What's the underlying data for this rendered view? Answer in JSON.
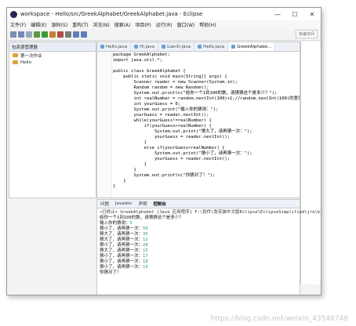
{
  "window": {
    "title": "workspace - Hello/src/GreekAlphabet/GreekAlphabet.java - Eclipse",
    "controls": [
      "—",
      "☐",
      "✕"
    ]
  },
  "menu": [
    "文件(F)",
    "编辑(E)",
    "源码(S)",
    "重构(T)",
    "浏览(N)",
    "搜索(A)",
    "项目(P)",
    "运行(R)",
    "窗口(W)",
    "帮助(H)"
  ],
  "quick_access": "快速访问",
  "left_pane": {
    "tab_label": "包资源管理器",
    "items": [
      "第一次作业",
      "Hello"
    ]
  },
  "editor": {
    "tabs": [
      "Hello.java",
      "Hi.java",
      "LianXi.java",
      "Hello.java",
      "GreekAlphabe..."
    ],
    "active_tab": 4,
    "code_lines": [
      "package GreekAlphabet;",
      "import java.util.*;",
      "",
      "public class GreekAlphabet {",
      "    public static void main(String[] args) {",
      "        Scanner reader = new Scanner(System.in);",
      "        Random random = new Random();",
      "        System.out.println(\"给你一个1到100的数，请猜猜这个是多少？\");",
      "        int realNumber = random.nextInt(100)+1;//random.nextInt(100)的意思",
      "        int yourGuess = 0;",
      "        System.out.print(\"输入你的猜测：\");",
      "        yourGuess = reader.nextInt();",
      "        while(yourGuess!=realNumber) {",
      "            if(yourGuess>realNumber) {",
      "                System.out.print(\"猜大了，请再猜一次：\");",
      "                yourGuess = reader.nextInt();",
      "            }",
      "            else if(yourGuess<realNumber) {",
      "                System.out.print(\"猜小了，请再猜一次：\");",
      "                yourGuess = reader.nextInt();",
      "            }",
      "        }",
      "        System.out.println(\"你猜对了！\");",
      "    }",
      "}"
    ]
  },
  "console": {
    "tabs": [
      "问题",
      "Javadoc",
      "声明",
      "控制台"
    ],
    "active_tab": 3,
    "header": "<已终止> GreekAlphabet [Java 应用程序] F:\\软件\\免安装中文版Eclipse\\EclipseSimplified\\jre\\bin\\javaw.exe (2018年9月2",
    "lines": [
      {
        "text": "给你一个1到100的数，请猜猜这个是多少？",
        "input": ""
      },
      {
        "text": "输入你的猜测：",
        "input": "5"
      },
      {
        "text": "猜小了，请再猜一次：",
        "input": "50"
      },
      {
        "text": "猜大了，请再猜一次：",
        "input": "35"
      },
      {
        "text": "猜大了，请再猜一次：",
        "input": "12"
      },
      {
        "text": "猜小了，请再猜一次：",
        "input": "28"
      },
      {
        "text": "猜大了，请再猜一次：",
        "input": "15"
      },
      {
        "text": "猜小了，请再猜一次：",
        "input": "17"
      },
      {
        "text": "猜小了，请再猜一次：",
        "input": "18"
      },
      {
        "text": "猜小了，请再猜一次：",
        "input": "19"
      },
      {
        "text": "你猜对了！",
        "input": ""
      }
    ]
  },
  "watermark": "https://blog.csdn.net/weixin_43548748"
}
